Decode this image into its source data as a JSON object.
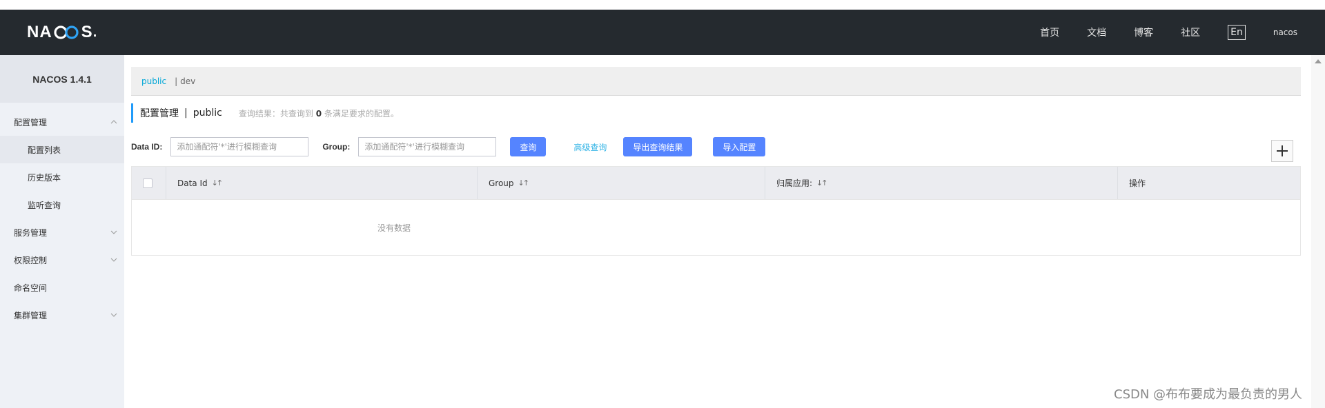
{
  "header": {
    "logo_left": "NA",
    "logo_right": "S",
    "logo_dot": ".",
    "nav": [
      "首页",
      "文档",
      "博客",
      "社区"
    ],
    "lang": "En",
    "user": "nacos"
  },
  "sidebar": {
    "title": "NACOS 1.4.1",
    "items": [
      {
        "label": "配置管理"
      },
      {
        "label": "配置列表"
      },
      {
        "label": "历史版本"
      },
      {
        "label": "监听查询"
      },
      {
        "label": "服务管理"
      },
      {
        "label": "权限控制"
      },
      {
        "label": "命名空间"
      },
      {
        "label": "集群管理"
      }
    ]
  },
  "namespace": {
    "active": "public",
    "separator": "|",
    "other": "dev"
  },
  "page": {
    "title": "配置管理",
    "pipe": "|",
    "namespace": "public",
    "hint_prefix": "查询结果：共查询到",
    "hint_count": "0",
    "hint_suffix": "条满足要求的配置。"
  },
  "search": {
    "dataid_label": "Data ID:",
    "dataid_placeholder": "添加通配符'*'进行模糊查询",
    "group_label": "Group:",
    "group_placeholder": "添加通配符'*'进行模糊查询",
    "query_btn": "查询",
    "advanced_link": "高级查询",
    "export_btn": "导出查询结果",
    "import_btn": "导入配置"
  },
  "table": {
    "columns": [
      "Data Id",
      "Group",
      "归属应用:",
      "操作"
    ],
    "empty": "没有数据"
  },
  "watermark": "CSDN @布布要成为最负责的男人",
  "colors": {
    "header_bg": "#252a2f",
    "sidebar_bg": "#eef1f6",
    "primary_btn": "#5584ff",
    "link": "#33b4e6",
    "title_bar": "#209bfa"
  }
}
